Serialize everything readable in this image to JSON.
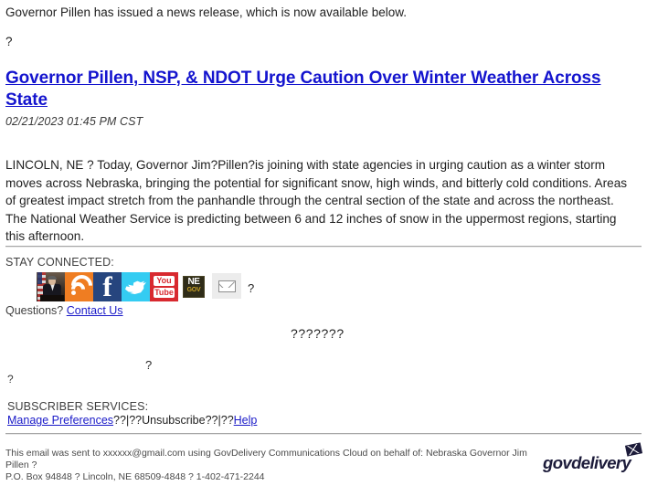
{
  "email": {
    "intro_text": "Governor Pillen has issued a news release, which is now available below.",
    "intro_placeholder_char": "?",
    "headline": "Governor Pillen, NSP, & NDOT Urge Caution Over Winter Weather Across State",
    "headline_color": "#1414CE",
    "date": "02/21/2023 01:45 PM CST",
    "body": "LINCOLN, NE ? Today, Governor Jim?Pillen?is joining with state agencies in urging caution as a winter storm moves across Nebraska, bringing the potential for significant snow, high winds, and bitterly cold conditions. Areas of greatest impact stretch from the panhandle through the central section of the state and across the northeast. The National Weather Service is predicting between 6 and 12 inches of snow in the uppermost regions, starting this afternoon."
  },
  "stay_connected": {
    "label": "STAY CONNECTED:",
    "icons": [
      {
        "name": "governor-photo-icon",
        "alt": "Governor photo",
        "color": "#3a2f27"
      },
      {
        "name": "rss-icon",
        "alt": "RSS",
        "color": "#ef7d22"
      },
      {
        "name": "facebook-icon",
        "alt": "Facebook",
        "glyph": "f",
        "color": "#26457e"
      },
      {
        "name": "twitter-icon",
        "alt": "Twitter",
        "color": "#34ccf2"
      },
      {
        "name": "youtube-icon",
        "alt": "YouTube",
        "line1": "You",
        "line2": "Tube",
        "color": "#d8292f"
      },
      {
        "name": "nebraska-gov-icon",
        "alt": "NE.gov",
        "line1": "NE",
        "line2": "GOV",
        "color": "#2f2c18"
      },
      {
        "name": "email-icon",
        "alt": "Email",
        "color": "#ececec"
      }
    ],
    "trailing_qmark": "?",
    "questions_label": "Questions?",
    "contact_link": "Contact Us",
    "right_qmarks": "???????",
    "float_qmark_mid": "?",
    "float_qmark_left": "?"
  },
  "subscriber": {
    "title": "SUBSCRIBER SERVICES:",
    "manage_preferences": "Manage Preferences",
    "separator_1": "??|??",
    "unsubscribe": "Unsubscribe",
    "separator_2": "??|??",
    "help": "Help"
  },
  "footer": {
    "line1": "This email was sent to xxxxxx@gmail.com using GovDelivery Communications Cloud on behalf of: Nebraska Governor Jim Pillen ?",
    "line2": "P.O. Box 94848 ? Lincoln, NE 68509-4848 ? 1-402-471-2244",
    "logo_text": "govdelivery",
    "logo_color": "#1c1b3a"
  }
}
